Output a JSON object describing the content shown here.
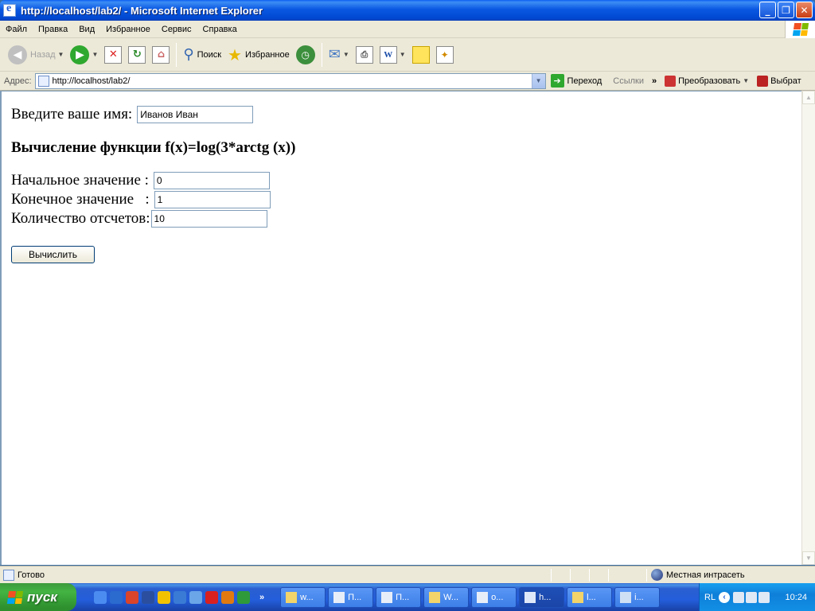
{
  "window": {
    "title": "http://localhost/lab2/ - Microsoft Internet Explorer",
    "minimize": "_",
    "maximize": "❐",
    "close": "✕"
  },
  "menu": [
    "Файл",
    "Правка",
    "Вид",
    "Избранное",
    "Сервис",
    "Справка"
  ],
  "toolbar": {
    "back_label": "Назад",
    "search_label": "Поиск",
    "favorites_label": "Избранное"
  },
  "address": {
    "label": "Адрес:",
    "url": "http://localhost/lab2/",
    "go_label": "Переход",
    "links_label": "Ссылки",
    "chevron": "»",
    "addon1_label": "Преобразовать",
    "addon2_label": "Выбрат"
  },
  "page": {
    "name_label": "Введите ваше имя:",
    "name_value": "Иванов Иван",
    "heading": "Вычисление функции f(x)=log(3*arctg (x))",
    "start_label": "Начальное значение :",
    "start_value": "0",
    "end_label": "Конечное значение   :",
    "end_value": "1",
    "count_label": "Количество отсчетов:",
    "count_value": "10",
    "button_label": "Вычислить"
  },
  "status": {
    "text": "Готово",
    "zone": "Местная интрасеть"
  },
  "taskbar": {
    "start_label": "пуск",
    "quicklaunch_chevron": "»",
    "tasks": [
      "w...",
      "П...",
      "П...",
      "W...",
      "o...",
      "h...",
      "l...",
      "i..."
    ],
    "tray_lang": "RL",
    "clock": "10:24"
  },
  "colors": {
    "titlebar": "#0a58e2",
    "chrome": "#ece9d8",
    "taskbar": "#245edb",
    "start": "#3c9a3c"
  }
}
